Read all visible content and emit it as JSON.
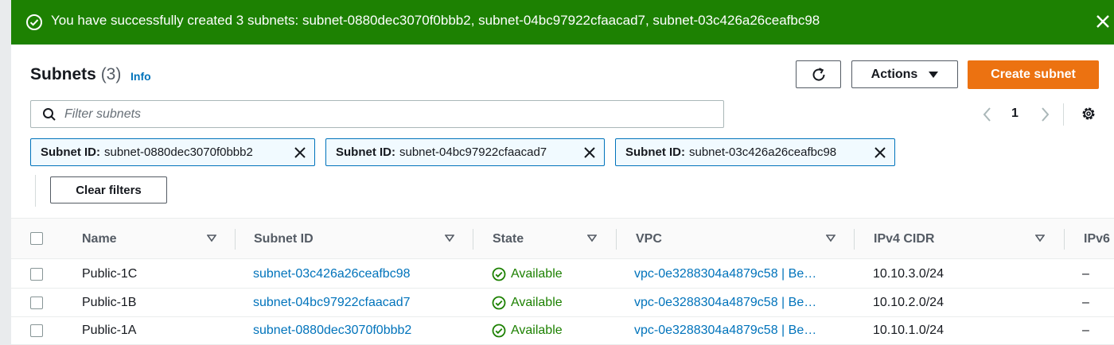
{
  "banner": {
    "message": "You have successfully created 3 subnets: subnet-0880dec3070f0bbb2, subnet-04bc97922cfaacad7, subnet-03c426a26ceafbc98",
    "icon": "check-circle-icon",
    "close_icon": "close-icon",
    "color": "#1d8102"
  },
  "header": {
    "title": "Subnets",
    "count": "(3)",
    "info": "Info",
    "actions_label": "Actions",
    "create_label": "Create subnet",
    "refresh_icon": "refresh-icon",
    "accent": "#ec7211"
  },
  "search": {
    "placeholder": "Filter subnets"
  },
  "pagination": {
    "page": "1"
  },
  "filters": [
    {
      "key": "Subnet ID:",
      "value": "subnet-0880dec3070f0bbb2"
    },
    {
      "key": "Subnet ID:",
      "value": "subnet-04bc97922cfaacad7"
    },
    {
      "key": "Subnet ID:",
      "value": "subnet-03c426a26ceafbc98"
    }
  ],
  "clear_filters_label": "Clear filters",
  "table": {
    "columns": [
      "Name",
      "Subnet ID",
      "State",
      "VPC",
      "IPv4 CIDR",
      "IPv6"
    ],
    "rows": [
      {
        "name": "Public-1C",
        "subnet_id": "subnet-03c426a26ceafbc98",
        "state": "Available",
        "vpc": "vpc-0e3288304a4879c58 | Be…",
        "ipv4": "10.10.3.0/24",
        "ipv6": "–"
      },
      {
        "name": "Public-1B",
        "subnet_id": "subnet-04bc97922cfaacad7",
        "state": "Available",
        "vpc": "vpc-0e3288304a4879c58 | Be…",
        "ipv4": "10.10.2.0/24",
        "ipv6": "–"
      },
      {
        "name": "Public-1A",
        "subnet_id": "subnet-0880dec3070f0bbb2",
        "state": "Available",
        "vpc": "vpc-0e3288304a4879c58 | Be…",
        "ipv4": "10.10.1.0/24",
        "ipv6": "–"
      }
    ]
  }
}
